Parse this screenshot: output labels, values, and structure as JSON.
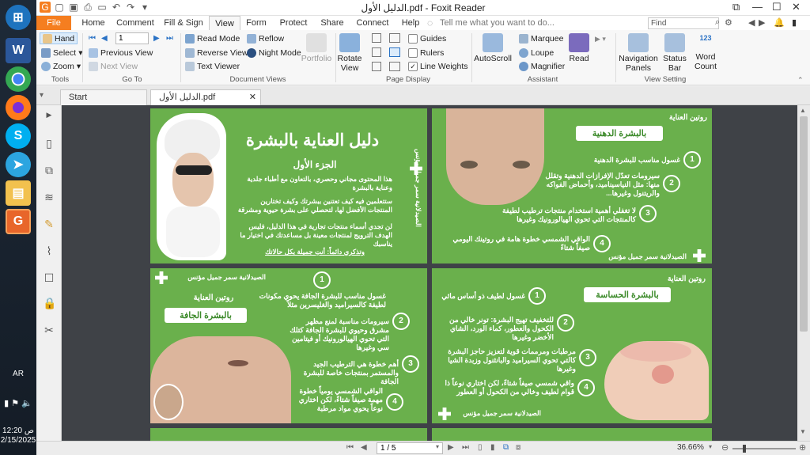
{
  "taskbar": {
    "lang": "AR",
    "time": "12:20 ص",
    "date": "2/15/2025"
  },
  "window": {
    "title": "الدليل الأول.pdf - Foxit Reader",
    "find_placeholder": "Find",
    "tell_me": "Tell me what you want to do..."
  },
  "tabs": [
    "File",
    "Home",
    "Comment",
    "Fill & Sign",
    "View",
    "Form",
    "Protect",
    "Share",
    "Connect",
    "Help"
  ],
  "ribbon": {
    "tools": {
      "hand": "Hand",
      "select": "Select",
      "zoom": "Zoom",
      "label": "Tools"
    },
    "goto": {
      "page_value": "1",
      "prev_view": "Previous View",
      "next_view": "Next View",
      "label": "Go To"
    },
    "docviews": {
      "read_mode": "Read Mode",
      "reverse_view": "Reverse View",
      "text_viewer": "Text Viewer",
      "reflow": "Reflow",
      "night_mode": "Night Mode",
      "portfolio": "Portfolio",
      "label": "Document Views"
    },
    "display": {
      "rotate": "Rotate View",
      "guides": "Guides",
      "rulers": "Rulers",
      "line_weights": "Line Weights",
      "label": "Page Display"
    },
    "assistant": {
      "autoscroll": "AutoScroll",
      "marquee": "Marquee",
      "loupe": "Loupe",
      "magnifier": "Magnifier",
      "read": "Read",
      "label": "Assistant"
    },
    "viewsetting": {
      "nav_panels": "Navigation Panels",
      "status_bar": "Status Bar",
      "word_count": "Word Count",
      "word_count_num": "123",
      "label": "View Setting"
    }
  },
  "doc_tabs": {
    "start": "Start",
    "file": "الدليل الأول.pdf"
  },
  "status": {
    "page": "1 / 5",
    "zoom": "36.66%"
  },
  "page1": {
    "title": "دليل العناية بالبشرة",
    "subtitle": "الجزء الأول",
    "para1": "هذا المحتوى مجاني وحصري، بالتعاون مع أطباء جلدية وعناية بالبشرة",
    "para2": "ستتعلمين فيه كيف تعتنين ببشرتك وكيف تختارين المنتجات الأفضل لها، لتحصلي على بشرة حيوية ومشرقة",
    "para3": "لن تجدي أسماء منتجات تجارية في هذا الدليل، فليس الهدف الترويج لمنتجات معينة بل مساعدتك في اختيار ما يناسبك",
    "footer": "وتذكري دائماً: أنتِ جميلة بكل حالاتك",
    "side_sig": "الصيدلانية سمر جميل مؤنس"
  },
  "page2": {
    "corner": "روتين العناية",
    "label": "بالبشرة الدهنية",
    "items": [
      {
        "n": "1",
        "text": "غسول مناسب للبشرة الدهنية"
      },
      {
        "n": "2",
        "text": "سيرومات تعدّل الإفرازات الدهنية وتقلل منها: مثل النياسيناميد، وأحماض الفواكه والريتنول وغيرها..."
      },
      {
        "n": "3",
        "text": "لا تغفلي أهمية استخدام منتجات ترطيب لطيفة كالمنتجات التي تحوي الهيالورونيك وغيرها"
      },
      {
        "n": "4",
        "text": "الواقي الشمسي خطوة هامة في روتينك اليومي صيفاً شتاءً"
      }
    ],
    "sig": "الصيدلانية سمر جميل مؤنس"
  },
  "page3": {
    "corner": "روتين العناية",
    "label": "بالبشرة الجافة",
    "items": [
      {
        "n": "1",
        "text": "غسول مناسب للبشرة الجافة يحوي مكونات لطيفة كالسيراميد والغليسرين مثلاً"
      },
      {
        "n": "2",
        "text": "سيرومات مناسبة لمنع مظهر مشرق وحيوي للبشرة الجافة كتلك التي تحوي الهيالورونيك أو فيتامين سي وغيرها"
      },
      {
        "n": "3",
        "text": "أهم خطوة هي الترطيب الجيد والمستمر بمنتجات خاصة للبشرة الجافة"
      },
      {
        "n": "4",
        "text": "الواقي الشمسي يومياً خطوة مهمة صيفاً شتاءً، لكن اختاري نوعاً يحوي مواد مرطبة"
      }
    ],
    "sig": "الصيدلانية سمر جميل مؤنس"
  },
  "page4": {
    "corner": "روتين العناية",
    "label": "بالبشرة الحساسة",
    "items": [
      {
        "n": "1",
        "text": "غسول لطيف ذو أساس مائي"
      },
      {
        "n": "2",
        "text": "للتخفيف تهيج البشرة: تونر خالي من الكحول والعطور، كماء الورد، الشاي الأخضر وغيرها"
      },
      {
        "n": "3",
        "text": "مرطبات ومرممات قوية لتعزيز حاجز البشرة كالتي تحوي السيراميد والبانثنول وزبدة الشيا وغيرها"
      },
      {
        "n": "4",
        "text": "واقي شمسي صيفاً شتاءً، لكن اختاري نوعاً ذا قوام لطيف وخالي من الكحول أو العطور"
      }
    ],
    "sig": "الصيدلانية سمر جميل مؤنس"
  }
}
